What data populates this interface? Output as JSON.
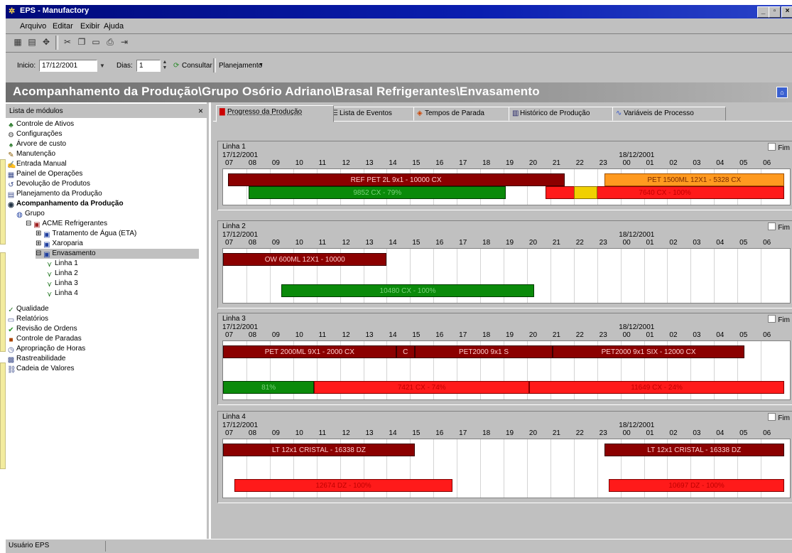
{
  "window": {
    "title": "EPS - Manufactory"
  },
  "menu": [
    "Arquivo",
    "Editar",
    "Exibir",
    "Ajuda"
  ],
  "toolbar": {
    "inicio_label": "Inicio:",
    "inicio_value": "17/12/2001",
    "dias_label": "Dias:",
    "dias_value": "1",
    "consultar_label": "Consultar",
    "planejamento_label": "Planejamento"
  },
  "path": "Acompanhamento da Produção\\Grupo Osório Adriano\\Brasal Refrigerantes\\Envasamento",
  "left": {
    "header": "Lista de módulos",
    "items": [
      {
        "label": "Controle de Ativos",
        "icon": "tree-icon"
      },
      {
        "label": "Configurações",
        "icon": "config-icon"
      },
      {
        "label": "Árvore de custo",
        "icon": "cost-tree-icon"
      },
      {
        "label": "Manutenção",
        "icon": "maintenance-icon"
      },
      {
        "label": "Entrada Manual",
        "icon": "manual-entry-icon"
      },
      {
        "label": "Painel de Operações",
        "icon": "operations-panel-icon"
      },
      {
        "label": "Devolução de Produtos",
        "icon": "return-icon"
      },
      {
        "label": "Planejamento da Produção",
        "icon": "planning-icon"
      },
      {
        "label": "Acompanhamento da Produção",
        "icon": "tracking-icon"
      }
    ],
    "tree": [
      {
        "label": "Grupo",
        "level": 0
      },
      {
        "label": "ACME Refrigerantes",
        "level": 1
      },
      {
        "label": "Tratamento de Água (ETA)",
        "level": 2
      },
      {
        "label": "Xaroparia",
        "level": 2
      },
      {
        "label": "Envasamento",
        "level": 2
      },
      {
        "label": "Linha 1",
        "level": 3
      },
      {
        "label": "Linha 2",
        "level": 3
      },
      {
        "label": "Linha 3",
        "level": 3
      },
      {
        "label": "Linha 4",
        "level": 3
      }
    ],
    "items2": [
      {
        "label": "Qualidade",
        "icon": "quality-icon"
      },
      {
        "label": "Relatórios",
        "icon": "reports-icon"
      },
      {
        "label": "Revisão de Ordens",
        "icon": "review-icon"
      },
      {
        "label": "Controle de Paradas",
        "icon": "stops-icon"
      },
      {
        "label": "Apropriação de Horas",
        "icon": "hours-icon"
      },
      {
        "label": "Rastreabilidade",
        "icon": "trace-icon"
      },
      {
        "label": "Cadeia de Valores",
        "icon": "value-chain-icon"
      }
    ]
  },
  "tabs": [
    "Progresso da Produção",
    "Lista de Eventos",
    "Tempos de Parada",
    "Histórico de Produção",
    "Variáveis de Processo"
  ],
  "hours": [
    "07",
    "08",
    "09",
    "10",
    "11",
    "12",
    "13",
    "14",
    "15",
    "16",
    "17",
    "18",
    "19",
    "20",
    "21",
    "22",
    "23",
    "00",
    "01",
    "02",
    "03",
    "04",
    "05",
    "06"
  ],
  "date1": "17/12/2001",
  "date2": "18/12/2001",
  "lines": [
    {
      "title": "Linha 1",
      "fim": "Fim",
      "bars": [
        {
          "row": 0,
          "start": 0.2,
          "end": 14.6,
          "color": "#8b0000",
          "label": "REF PET 2L 9x1 - 10000 CX"
        },
        {
          "row": 0,
          "start": 16.3,
          "end": 24.8,
          "color": "#ff9a20",
          "label": "PET 1500ML 12X1 - 5328 CX"
        },
        {
          "row": 1,
          "start": 1.1,
          "end": 12.1,
          "color": "#0a8a0a",
          "label": "9852 CX - 79%"
        },
        {
          "row": 1,
          "start": 13.8,
          "end": 26,
          "color": "#ff1a1a",
          "label": "7640 CX - 100%"
        },
        {
          "row": 1,
          "start": 15.0,
          "end": 16.0,
          "color": "#f0d000",
          "label": ""
        }
      ]
    },
    {
      "title": "Linha 2",
      "fim": "Fim",
      "bars": [
        {
          "row": 0,
          "start": 0,
          "end": 7.0,
          "color": "#8b0000",
          "label": "OW 600ML 12X1 - 10000"
        },
        {
          "row": 1,
          "start": 2.5,
          "end": 13.3,
          "color": "#0a8a0a",
          "label": "10480 CX - 100%"
        }
      ]
    },
    {
      "title": "Linha 3",
      "fim": "Fim",
      "bars": [
        {
          "row": 0,
          "start": 0,
          "end": 7.4,
          "color": "#8b0000",
          "label": "PET 2000ML 9X1 - 2000 CX"
        },
        {
          "row": 0,
          "start": 7.4,
          "end": 8.2,
          "color": "#8b0000",
          "label": "C"
        },
        {
          "row": 0,
          "start": 8.2,
          "end": 14.1,
          "color": "#8b0000",
          "label": "PET2000 9x1 S"
        },
        {
          "row": 0,
          "start": 14.1,
          "end": 22.3,
          "color": "#8b0000",
          "label": "PET2000 9x1 SIX - 12000 CX"
        },
        {
          "row": 1,
          "start": 0,
          "end": 3.9,
          "color": "#0a8a0a",
          "label": "81%"
        },
        {
          "row": 1,
          "start": 3.9,
          "end": 13.1,
          "color": "#ff1a1a",
          "label": "7421 CX - 74%"
        },
        {
          "row": 1,
          "start": 13.1,
          "end": 26,
          "color": "#ff1a1a",
          "label": "11649 CX - 24%"
        }
      ]
    },
    {
      "title": "Linha 4",
      "fim": "Fim",
      "bars": [
        {
          "row": 0,
          "start": 0,
          "end": 8.2,
          "color": "#8b0000",
          "label": "LT 12x1 CRISTAL - 16338 DZ"
        },
        {
          "row": 0,
          "start": 16.3,
          "end": 24.5,
          "color": "#8b0000",
          "label": "LT 12x1 CRISTAL - 16338 DZ"
        },
        {
          "row": 1,
          "start": 0.5,
          "end": 9.8,
          "color": "#ff1a1a",
          "label": "12674 DZ - 100%"
        },
        {
          "row": 1,
          "start": 16.5,
          "end": 26,
          "color": "#ff1a1a",
          "label": "10697 DZ - 100%"
        }
      ]
    }
  ],
  "status": "Usuário EPS"
}
